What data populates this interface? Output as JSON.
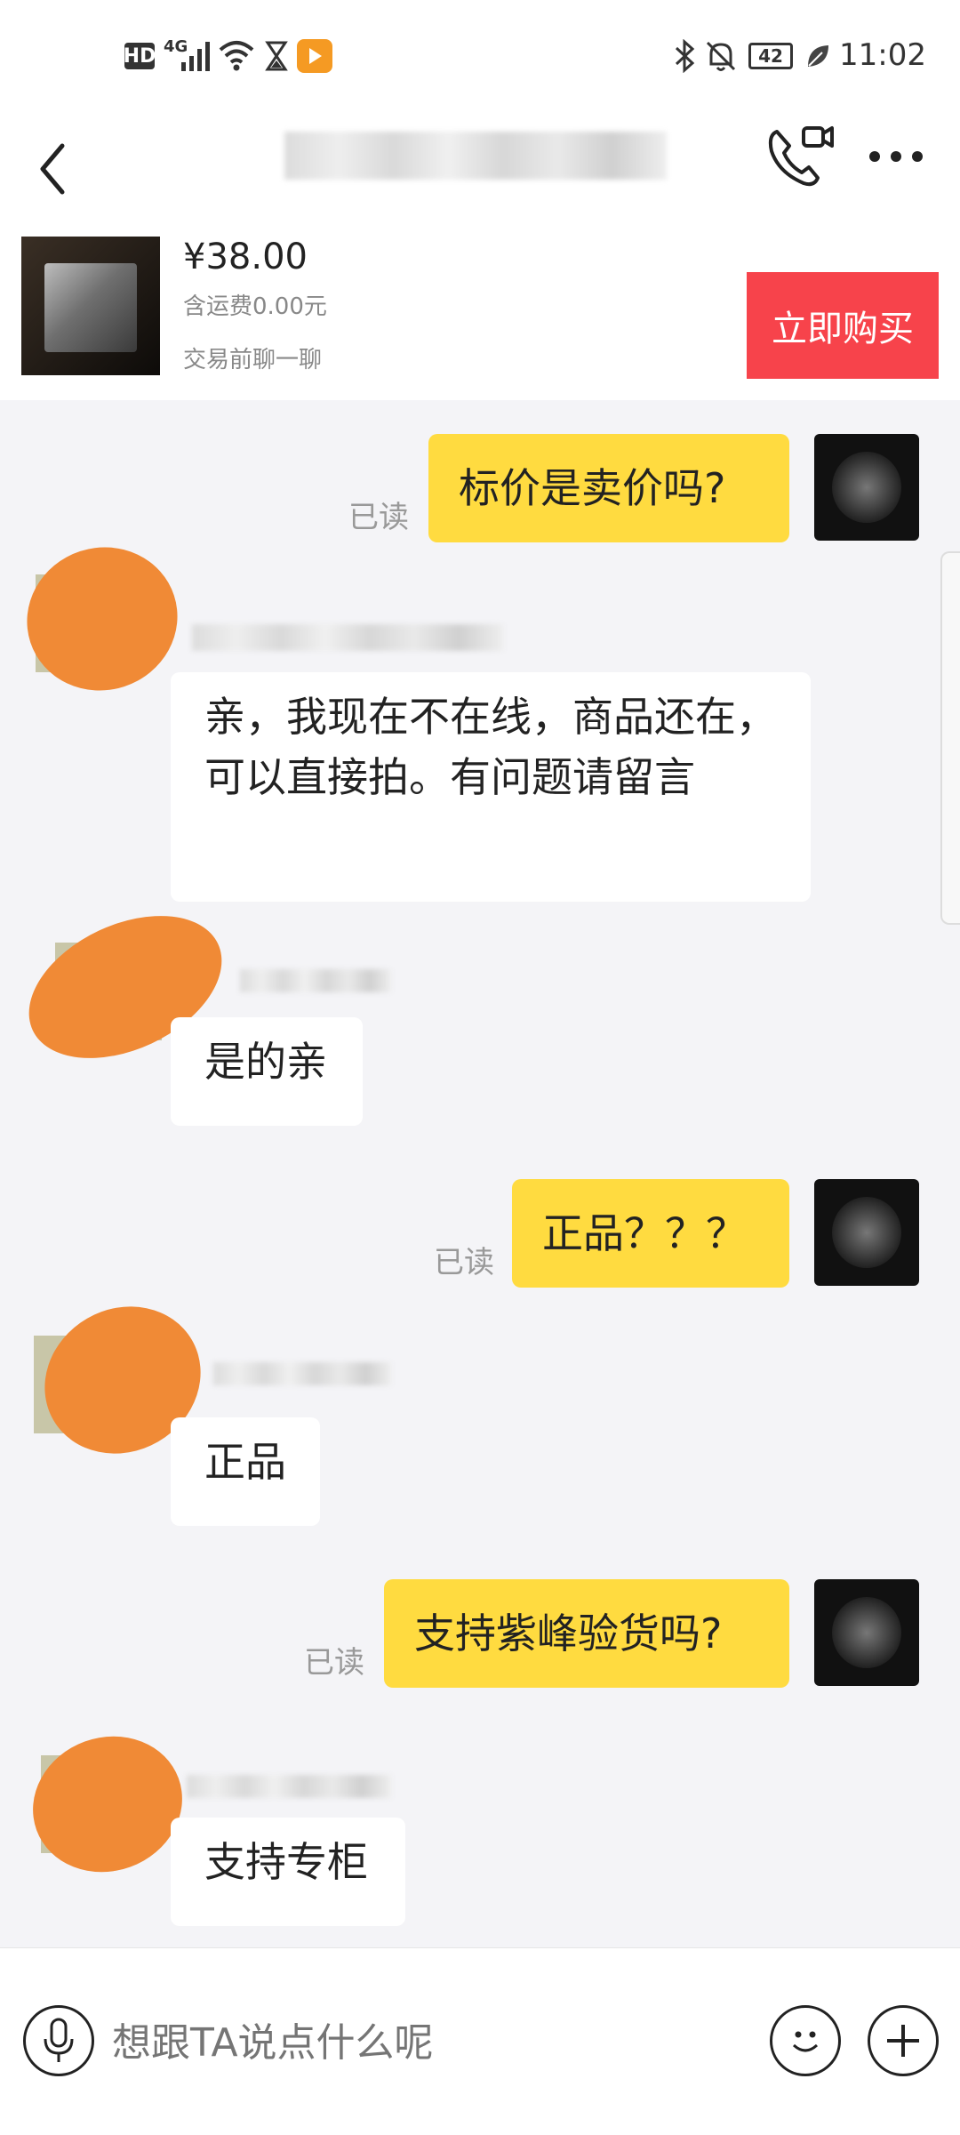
{
  "status_bar": {
    "hd_label": "HD",
    "network_label": "4G",
    "battery_level": "42",
    "time": "11:02"
  },
  "product": {
    "price": "¥38.00",
    "shipping": "含运费0.00元",
    "note": "交易前聊一聊",
    "buy_button": "立即购买",
    "buy_color": "#f7434b"
  },
  "messages": [
    {
      "side": "mine",
      "text": "标价是卖价吗?",
      "status": "已读"
    },
    {
      "side": "theirs",
      "text": "亲，我现在不在线，商品还在，可以直接拍。有问题请留言"
    },
    {
      "side": "theirs",
      "text": "是的亲"
    },
    {
      "side": "mine",
      "text": "正品？？？",
      "status": "已读"
    },
    {
      "side": "theirs",
      "text": "正品"
    },
    {
      "side": "mine",
      "text": "支持紫峰验货吗?",
      "status": "已读"
    },
    {
      "side": "theirs",
      "text": "支持专柜"
    }
  ],
  "input": {
    "placeholder": "想跟TA说点什么呢"
  },
  "colors": {
    "my_bubble": "#ffdb40",
    "background": "#f4f4f7"
  }
}
